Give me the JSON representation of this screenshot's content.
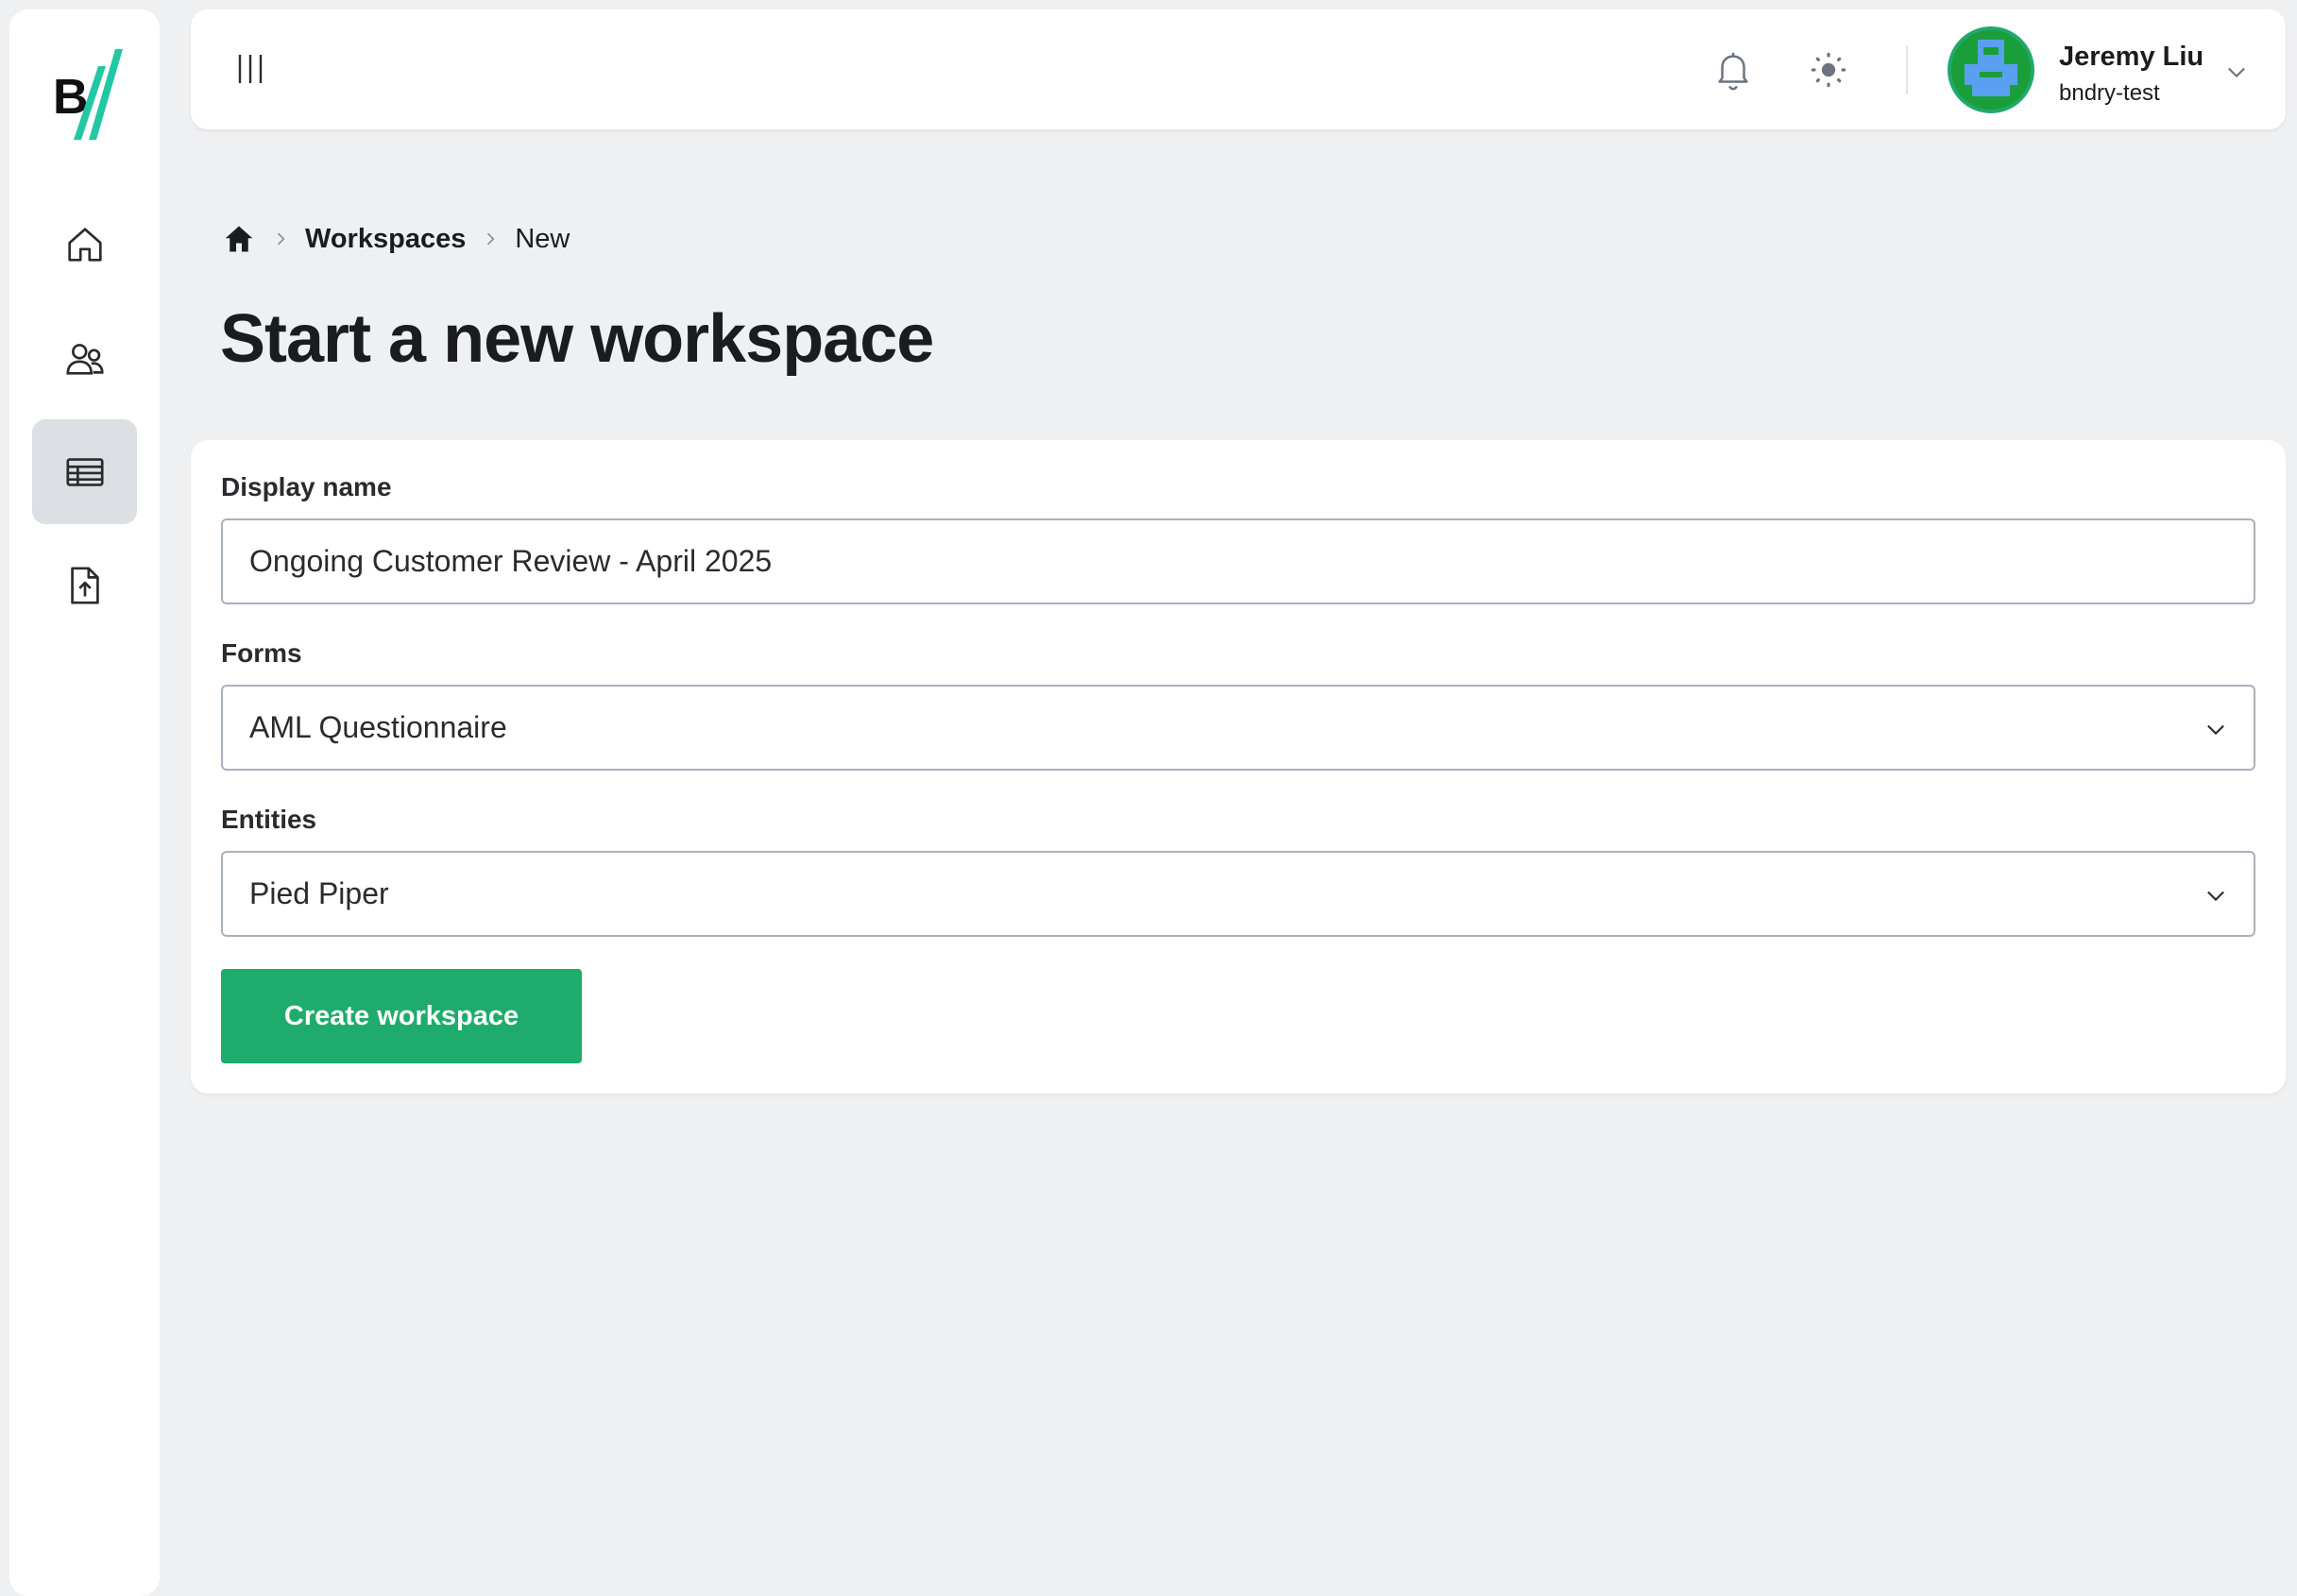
{
  "brand": {
    "logo_letter": "B",
    "accent_color": "#22c7a4"
  },
  "sidebar": {
    "items": [
      {
        "name": "home",
        "icon": "home-icon",
        "active": false
      },
      {
        "name": "users",
        "icon": "users-icon",
        "active": false
      },
      {
        "name": "workspaces",
        "icon": "table-icon",
        "active": true
      },
      {
        "name": "upload",
        "icon": "file-upload-icon",
        "active": false
      }
    ]
  },
  "topbar": {
    "icons": [
      "menu-icon",
      "bell-icon",
      "sun-icon",
      "chevron-down-icon"
    ],
    "user": {
      "name": "Jeremy Liu",
      "org": "bndry-test"
    }
  },
  "breadcrumb": {
    "home_icon": "home-icon",
    "link": "Workspaces",
    "current": "New"
  },
  "page": {
    "title": "Start a new workspace"
  },
  "form": {
    "display_name": {
      "label": "Display name",
      "value": "Ongoing Customer Review - April 2025"
    },
    "forms": {
      "label": "Forms",
      "selected": "AML Questionnaire"
    },
    "entities": {
      "label": "Entities",
      "selected": "Pied Piper"
    },
    "submit_label": "Create workspace"
  },
  "colors": {
    "primary_button": "#1fab6c",
    "avatar_ring": "#22a86c",
    "page_bg": "#eff0f2"
  }
}
